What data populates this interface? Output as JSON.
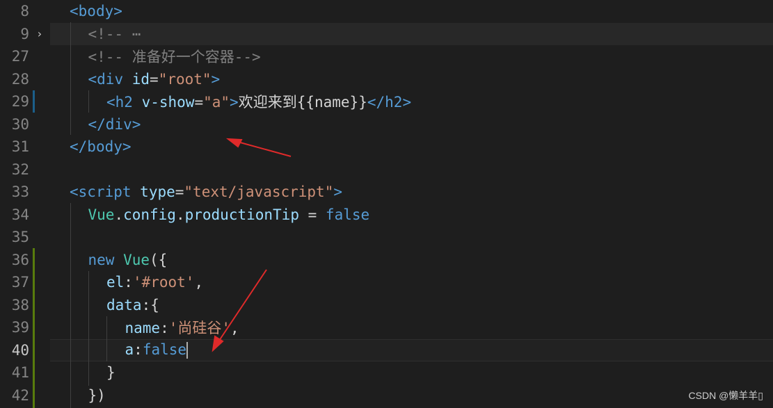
{
  "editor": {
    "lines": [
      {
        "num": "8",
        "segments": [
          [
            "tag-bracket",
            "<"
          ],
          [
            "tag",
            "body"
          ],
          [
            "tag-bracket",
            ">"
          ]
        ]
      },
      {
        "num": "9",
        "fold": "›",
        "segments": [
          [
            "bracket",
            "<!-- "
          ],
          [
            "bracket",
            "⋯"
          ]
        ]
      },
      {
        "num": "27",
        "segments": [
          [
            "bracket",
            "<!-- 准备好一个容器-->"
          ]
        ]
      },
      {
        "num": "28",
        "segments": [
          [
            "tag-bracket",
            "<"
          ],
          [
            "tag",
            "div "
          ],
          [
            "attr",
            "id"
          ],
          [
            "plain",
            "="
          ],
          [
            "str",
            "\"root\""
          ],
          [
            "tag-bracket",
            ">"
          ]
        ]
      },
      {
        "num": "29",
        "segments": [
          [
            "tag-bracket",
            "<"
          ],
          [
            "tag",
            "h2 "
          ],
          [
            "attr",
            "v-show"
          ],
          [
            "plain",
            "="
          ],
          [
            "str",
            "\"a\""
          ],
          [
            "tag-bracket",
            ">"
          ],
          [
            "plain",
            "欢迎来到{{name}}"
          ],
          [
            "tag-bracket",
            "</"
          ],
          [
            "tag",
            "h2"
          ],
          [
            "tag-bracket",
            ">"
          ]
        ]
      },
      {
        "num": "30",
        "segments": [
          [
            "tag-bracket",
            "</"
          ],
          [
            "tag",
            "div"
          ],
          [
            "tag-bracket",
            ">"
          ]
        ]
      },
      {
        "num": "31",
        "segments": [
          [
            "tag-bracket",
            "</"
          ],
          [
            "tag",
            "body"
          ],
          [
            "tag-bracket",
            ">"
          ]
        ]
      },
      {
        "num": "32",
        "segments": []
      },
      {
        "num": "33",
        "segments": [
          [
            "tag-bracket",
            "<"
          ],
          [
            "tag",
            "script "
          ],
          [
            "attr",
            "type"
          ],
          [
            "plain",
            "="
          ],
          [
            "str",
            "\"text/javascript\""
          ],
          [
            "tag-bracket",
            ">"
          ]
        ]
      },
      {
        "num": "34",
        "segments": [
          [
            "cls",
            "Vue"
          ],
          [
            "plain",
            "."
          ],
          [
            "prop",
            "config"
          ],
          [
            "plain",
            "."
          ],
          [
            "prop",
            "productionTip"
          ],
          [
            "plain",
            " = "
          ],
          [
            "kw",
            "false"
          ]
        ]
      },
      {
        "num": "35",
        "segments": []
      },
      {
        "num": "36",
        "segments": [
          [
            "kw",
            "new "
          ],
          [
            "cls",
            "Vue"
          ],
          [
            "plain",
            "({"
          ]
        ]
      },
      {
        "num": "37",
        "segments": [
          [
            "prop",
            "el"
          ],
          [
            "plain",
            ":"
          ],
          [
            "str",
            "'#root'"
          ],
          [
            "plain",
            ","
          ]
        ]
      },
      {
        "num": "38",
        "segments": [
          [
            "prop",
            "data"
          ],
          [
            "plain",
            ":{"
          ]
        ]
      },
      {
        "num": "39",
        "segments": [
          [
            "prop",
            "name"
          ],
          [
            "plain",
            ":"
          ],
          [
            "str",
            "'尚硅谷'"
          ],
          [
            "plain",
            ","
          ]
        ]
      },
      {
        "num": "40",
        "segments": [
          [
            "prop",
            "a"
          ],
          [
            "plain",
            ":"
          ],
          [
            "kw",
            "false"
          ]
        ]
      },
      {
        "num": "41",
        "segments": [
          [
            "plain",
            "}"
          ]
        ]
      },
      {
        "num": "42",
        "segments": [
          [
            "plain",
            "})"
          ]
        ]
      }
    ]
  },
  "watermark": "CSDN @懒羊羊▯",
  "colors": {
    "background": "#1e1e1e",
    "annotation_arrow": "#e02a2a"
  }
}
